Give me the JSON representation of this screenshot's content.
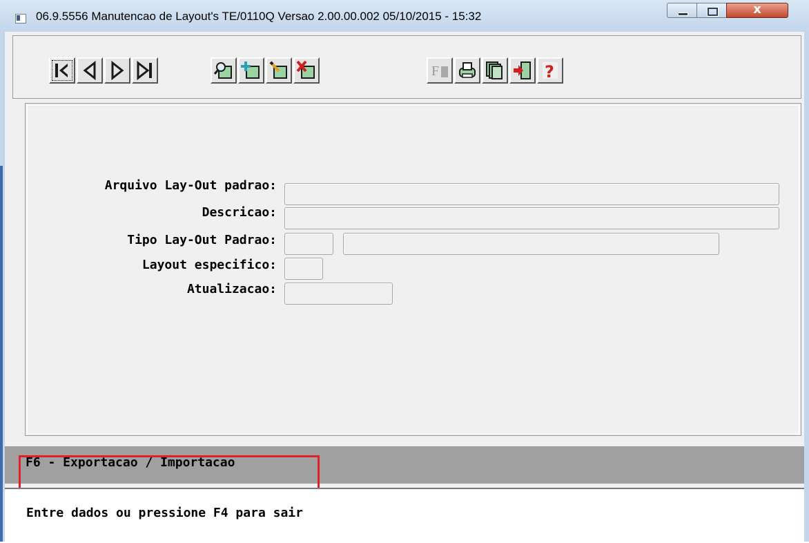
{
  "window": {
    "title": "06.9.5556 Manutencao  de Layout's TE/0110Q Versao 2.00.00.002 05/10/2015 - 15:32",
    "close_glyph": "x"
  },
  "toolbar": {
    "nav_buttons": [
      "first-record-icon",
      "previous-record-icon",
      "next-record-icon",
      "last-record-icon"
    ],
    "edit_buttons": [
      "search-icon",
      "add-record-icon",
      "edit-record-icon",
      "delete-record-icon"
    ],
    "util_buttons": [
      "filter-icon",
      "print-icon",
      "copy-icon",
      "exit-icon",
      "help-icon"
    ],
    "filter_glyph": "F",
    "help_glyph": "?"
  },
  "form": {
    "arquivo_label": "Arquivo Lay-Out padrao:",
    "arquivo_value": "",
    "descricao_label": "Descricao:",
    "descricao_value": "",
    "tipo_label": "Tipo Lay-Out Padrao:",
    "tipo_code_value": "",
    "tipo_desc_value": "",
    "especifico_label": "Layout especifico:",
    "especifico_value": "",
    "atualizacao_label": "Atualizacao:",
    "atualizacao_value": ""
  },
  "function_bar": {
    "f6_label": "F6 - Exportacao / Importacao"
  },
  "status": {
    "message": "Entre dados ou pressione F4 para sair"
  },
  "colors": {
    "highlight": "#e0202a",
    "icon_green": "#9bd3a2",
    "icon_dark": "#1a1a1a"
  }
}
